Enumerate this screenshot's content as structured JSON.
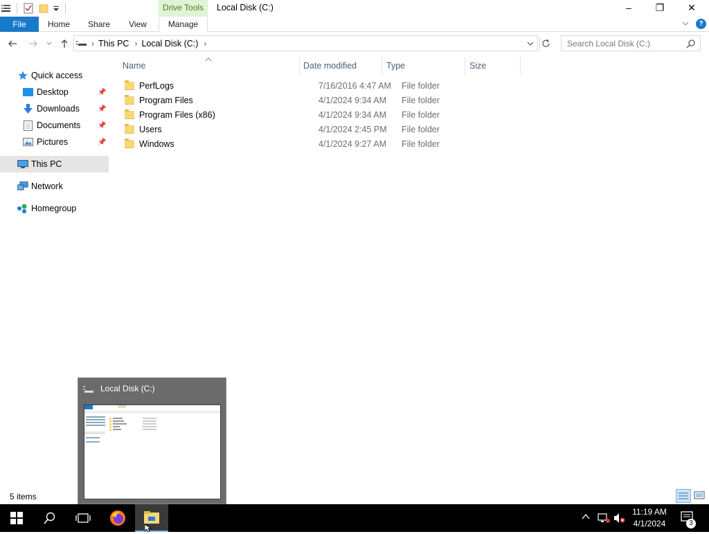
{
  "window": {
    "title": "Local Disk (C:)",
    "minimize_glyph": "–",
    "restore_glyph": "❐",
    "close_glyph": "✕"
  },
  "ribbon": {
    "contextual_group": "Drive Tools",
    "tabs": [
      "File",
      "Home",
      "Share",
      "View",
      "Manage"
    ]
  },
  "address": {
    "crumbs": [
      "This PC",
      "Local Disk (C:)"
    ],
    "separator": "›"
  },
  "search": {
    "placeholder": "Search Local Disk (C:)"
  },
  "nav": {
    "quick_access": "Quick access",
    "desktop": "Desktop",
    "downloads": "Downloads",
    "documents": "Documents",
    "pictures": "Pictures",
    "this_pc": "This PC",
    "network": "Network",
    "homegroup": "Homegroup"
  },
  "columns": {
    "name": "Name",
    "date": "Date modified",
    "type": "Type",
    "size": "Size"
  },
  "files": [
    {
      "name": "PerfLogs",
      "date": "7/16/2016 4:47 AM",
      "type": "File folder"
    },
    {
      "name": "Program Files",
      "date": "4/1/2024 9:34 AM",
      "type": "File folder"
    },
    {
      "name": "Program Files (x86)",
      "date": "4/1/2024 9:34 AM",
      "type": "File folder"
    },
    {
      "name": "Users",
      "date": "4/1/2024 2:45 PM",
      "type": "File folder"
    },
    {
      "name": "Windows",
      "date": "4/1/2024 9:27 AM",
      "type": "File folder"
    }
  ],
  "status": {
    "items": "5 items"
  },
  "thumbnail": {
    "title": "Local Disk (C:)"
  },
  "tray": {
    "time": "11:19 AM",
    "date": "4/1/2024",
    "notifications": "3"
  },
  "colors": {
    "accent": "#1979ca",
    "drive_tools_bg": "#dff3d5",
    "selected_nav": "#e5e5e5"
  }
}
